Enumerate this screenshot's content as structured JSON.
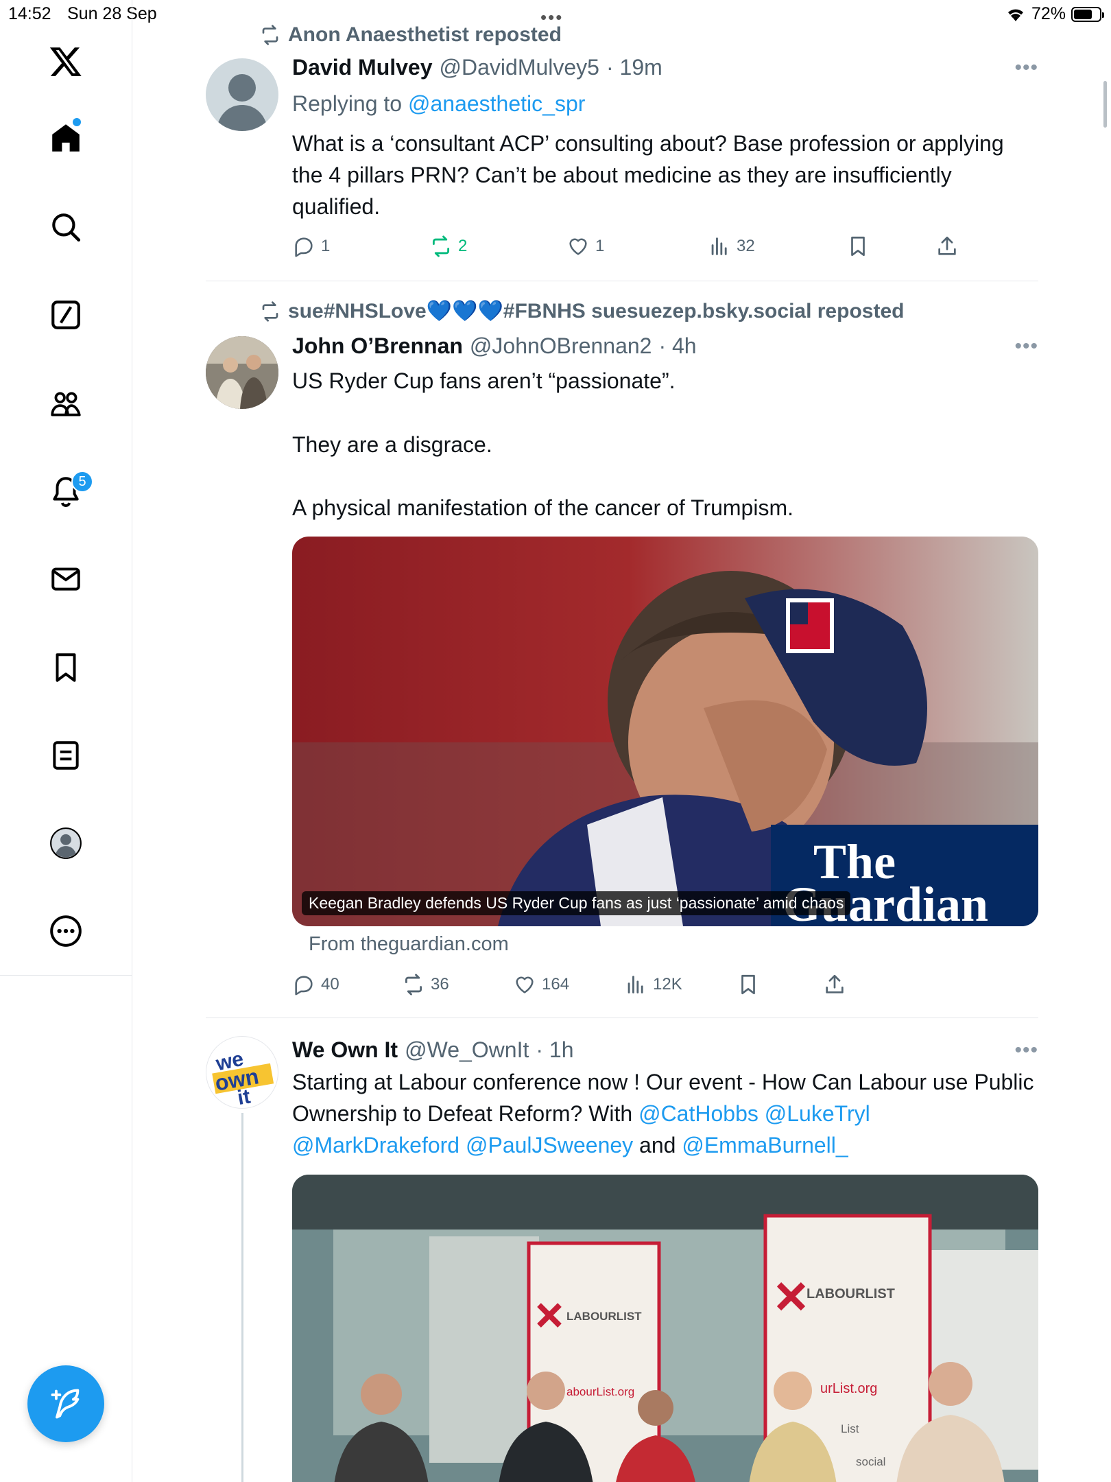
{
  "status_bar": {
    "time": "14:52",
    "date": "Sun 28 Sep",
    "battery": "72%",
    "battery_level": 0.72
  },
  "sidebar": {
    "items": [
      "x-logo",
      "home",
      "search",
      "grok",
      "communities",
      "notifications",
      "messages",
      "bookmarks",
      "lists",
      "profile",
      "more"
    ],
    "notification_badge": "5"
  },
  "tweets": [
    {
      "repost_by": "Anon Anaesthetist reposted",
      "name": "David Mulvey",
      "handle": "@DavidMulvey5",
      "time": "· 19m",
      "replying_prefix": "Replying to",
      "replying_to": "@anaesthetic_spr",
      "text": "What is a ‘consultant ACP’ consulting about? Base profession or applying the 4 pillars PRN? Can’t be about medicine as they are insufficiently qualified.",
      "replies": "1",
      "reposts": "2",
      "likes": "1",
      "views": "32"
    },
    {
      "repost_by": "sue#NHSLove💙💙💙#FBNHS suesuezep.bsky.social reposted",
      "name": "John O’Brennan",
      "handle": "@JohnOBrennan2",
      "time": "· 4h",
      "text_lines": [
        "US Ryder Cup fans aren’t “passionate”.",
        "They are a disgrace.",
        "A physical manifestation of the cancer of Trumpism."
      ],
      "card_caption": "Keegan Bradley defends US Ryder Cup fans as just ‘passionate’ amid chaos",
      "card_brand_line1": "The",
      "card_brand_line2": "Guardian",
      "card_source": "From theguardian.com",
      "replies": "40",
      "reposts": "36",
      "likes": "164",
      "views": "12K"
    },
    {
      "name": "We Own It",
      "handle": "@We_OwnIt",
      "time": "· 1h",
      "avatar_text": [
        "we",
        "own",
        "it"
      ],
      "text_part1": "Starting at Labour conference now ! Our event - How Can Labour use Public Ownership to Defeat Reform? With ",
      "mentions1": "@CatHobbs @LukeTryl @MarkDrakeford @PaulJSweeney",
      "text_and": " and ",
      "mentions2": "@EmmaBurnell_",
      "banner_left": "LABOURLIST",
      "banner_right": "LABOURLIST",
      "banner_url_left": "abourList.org",
      "banner_url_right": "urList.org",
      "banner_extra1": "List",
      "banner_extra2": "social"
    }
  ]
}
